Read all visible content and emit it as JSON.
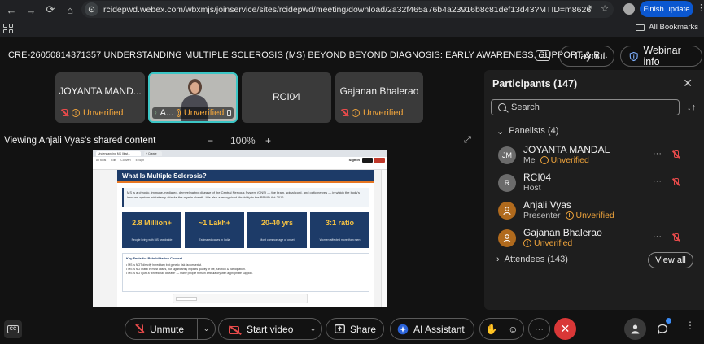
{
  "browser": {
    "url": "rcidepwd.webex.com/wbxmjs/joinservice/sites/rcidepwd/meeting/download/2a32f465a76b4a23916b8c81def13d43?MTID=m8626f092...",
    "finish_update": "Finish update",
    "all_bookmarks": "All Bookmarks"
  },
  "meeting": {
    "title": "CRE-26050814371357 UNDERSTANDING MULTIPLE SCLEROSIS (MS) BEYOND BEYOND DIAGNOSIS: EARLY AWARENESS, SUPPORT & R...",
    "cc_label": "CC",
    "layout_label": "Layout",
    "webinar_info_label": "Webinar info"
  },
  "tiles": [
    {
      "name": "JOYANTA MAND...",
      "status": "Unverified"
    },
    {
      "name": "A...",
      "status": "Unverified"
    },
    {
      "name": "RCI04",
      "status": ""
    },
    {
      "name": "Gajanan Bhalerao",
      "status": "Unverified"
    }
  ],
  "share": {
    "viewing_label": "Viewing Anjali Vyas's shared content",
    "zoom_minus": "−",
    "zoom_level": "100%",
    "zoom_plus": "+"
  },
  "slide": {
    "tab_label": "Understanding MS Illust...",
    "tab2_label": "+ Create",
    "toolbar_items": [
      "All tools",
      "Edit",
      "Convert",
      "E-Sign"
    ],
    "sign_in": "Sign in",
    "heading": "What Is Multiple Sclerosis?",
    "intro": "MS is a chronic, immune-mediated, demyelinating disease of the Central Nervous System (CNS) — the brain, spinal cord, and optic nerves — in which the body's immune system mistakenly attacks the myelin sheath. It is also a recognized disability in the RPWD Act 2016.",
    "stats": [
      {
        "value": "2.8 Million+",
        "label": "People living with MS worldwide"
      },
      {
        "value": "~1 Lakh+",
        "label": "Estimated cases in India"
      },
      {
        "value": "20-40 yrs",
        "label": "Most common age of onset"
      },
      {
        "value": "3:1 ratio",
        "label": "Women affected more than men"
      }
    ],
    "facts_title": "Key Facts for Rehabilitation Context",
    "facts": [
      "• MS is NOT directly hereditary but genetic risk factors exist.",
      "• MS is NOT fatal in most cases, but significantly impacts quality of life, function & participation.",
      "• MS is NOT just a 'wheelchair disease' — many people remain ambulatory with appropriate support."
    ]
  },
  "participants": {
    "title": "Participants (147)",
    "search_placeholder": "Search",
    "panelists_label": "Panelists (4)",
    "attendees_label": "Attendees (143)",
    "view_all": "View all",
    "list": [
      {
        "initials": "JM",
        "name": "JOYANTA MANDAL",
        "role": "Me",
        "status": "Unverified"
      },
      {
        "initials": "R",
        "name": "RCI04",
        "role": "Host",
        "status": ""
      },
      {
        "initials": "",
        "name": "Anjali Vyas",
        "role": "Presenter",
        "status": "Unverified"
      },
      {
        "initials": "",
        "name": "Gajanan Bhalerao",
        "role": "",
        "status": "Unverified"
      }
    ]
  },
  "controls": {
    "unmute": "Unmute",
    "start_video": "Start video",
    "share": "Share",
    "ai_assistant": "AI Assistant",
    "more": "···",
    "leave": "✕"
  },
  "colors": {
    "accent": "#0b57d0",
    "unverified": "#f1a53c",
    "muted_red": "#e84b4b",
    "leave_red": "#d93737",
    "active_tile": "#3cc6c6",
    "slide_navy": "#1d3b68"
  }
}
